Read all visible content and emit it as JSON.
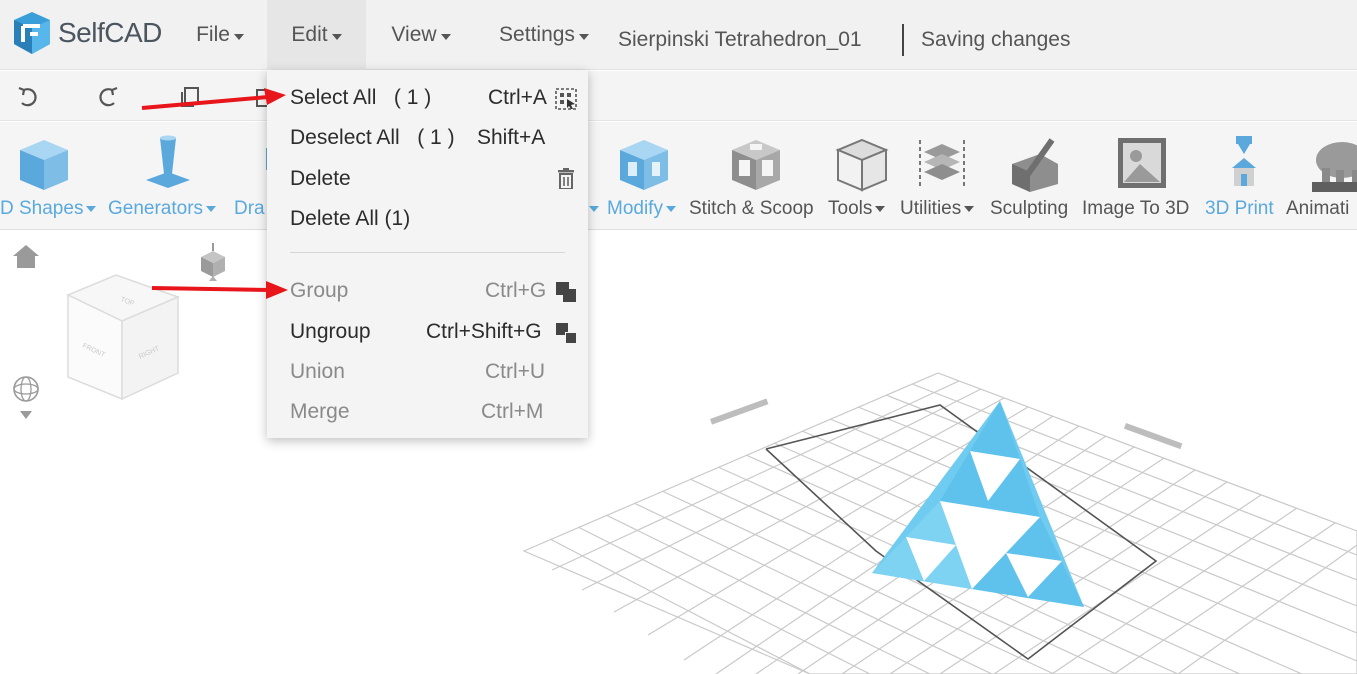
{
  "app": {
    "name": "SelfCAD"
  },
  "menubar": {
    "file": "File",
    "edit": "Edit",
    "view": "View",
    "settings": "Settings",
    "document_title": "Sierpinski Tetrahedron_01",
    "save_status": "Saving changes"
  },
  "ribbon": {
    "tools": [
      {
        "label": "D Shapes",
        "has_menu": true
      },
      {
        "label": "Generators",
        "has_menu": true
      },
      {
        "label": "Dra",
        "has_menu": false
      },
      {
        "label": "Modify",
        "has_menu": true
      },
      {
        "label": "Stitch & Scoop",
        "has_menu": false
      },
      {
        "label": "Tools",
        "has_menu": true
      },
      {
        "label": "Utilities",
        "has_menu": true
      },
      {
        "label": "Sculpting",
        "has_menu": false
      },
      {
        "label": "Image To 3D",
        "has_menu": false
      },
      {
        "label": "3D Print",
        "has_menu": false
      },
      {
        "label": "Animati",
        "has_menu": false
      }
    ]
  },
  "edit_menu": {
    "items": [
      {
        "label": "Select All",
        "count": "( 1 )",
        "shortcut": "Ctrl+A",
        "icon": "select-all-icon",
        "enabled": true
      },
      {
        "label": "Deselect All",
        "count": "( 1 )",
        "shortcut": "Shift+A",
        "icon": "",
        "enabled": true
      },
      {
        "label": "Delete",
        "count": "",
        "shortcut": "",
        "icon": "trash-icon",
        "enabled": true
      },
      {
        "label": "Delete All (1)",
        "count": "",
        "shortcut": "",
        "icon": "",
        "enabled": true
      },
      {
        "label": "Group",
        "count": "",
        "shortcut": "Ctrl+G",
        "icon": "group-icon",
        "enabled": false
      },
      {
        "label": "Ungroup",
        "count": "",
        "shortcut": "Ctrl+Shift+G",
        "icon": "ungroup-icon",
        "enabled": true
      },
      {
        "label": "Union",
        "count": "",
        "shortcut": "Ctrl+U",
        "icon": "",
        "enabled": false
      },
      {
        "label": "Merge",
        "count": "",
        "shortcut": "Ctrl+M",
        "icon": "",
        "enabled": false
      }
    ]
  },
  "viewcube": {
    "top": "TOP",
    "front": "FRONT",
    "right": "RIGHT"
  },
  "colors": {
    "accent_blue": "#5aa9dd",
    "model_blue": "#6fcbef",
    "annotation_red": "#e8151b",
    "menubar_bg": "#f1f1f1"
  }
}
